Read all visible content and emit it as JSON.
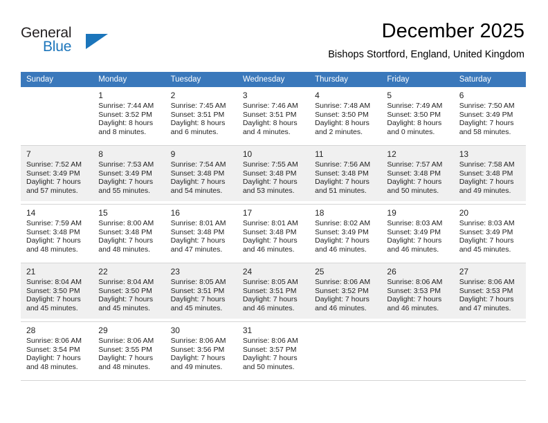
{
  "brand": {
    "word1": "General",
    "word2": "Blue",
    "triangle_color": "#1b75bb",
    "text_color": "#231f20"
  },
  "header": {
    "title": "December 2025",
    "subtitle": "Bishops Stortford, England, United Kingdom"
  },
  "theme": {
    "header_row_bg": "#3a78bb",
    "header_row_text": "#ffffff",
    "shaded_cell_bg": "#f0f0f0",
    "grid_line": "#d4d4d4"
  },
  "weekdays": [
    "Sunday",
    "Monday",
    "Tuesday",
    "Wednesday",
    "Thursday",
    "Friday",
    "Saturday"
  ],
  "weeks": [
    [
      {
        "day": "",
        "sunrise": "",
        "sunset": "",
        "daylight1": "",
        "daylight2": ""
      },
      {
        "day": "1",
        "sunrise": "Sunrise: 7:44 AM",
        "sunset": "Sunset: 3:52 PM",
        "daylight1": "Daylight: 8 hours",
        "daylight2": "and 8 minutes."
      },
      {
        "day": "2",
        "sunrise": "Sunrise: 7:45 AM",
        "sunset": "Sunset: 3:51 PM",
        "daylight1": "Daylight: 8 hours",
        "daylight2": "and 6 minutes."
      },
      {
        "day": "3",
        "sunrise": "Sunrise: 7:46 AM",
        "sunset": "Sunset: 3:51 PM",
        "daylight1": "Daylight: 8 hours",
        "daylight2": "and 4 minutes."
      },
      {
        "day": "4",
        "sunrise": "Sunrise: 7:48 AM",
        "sunset": "Sunset: 3:50 PM",
        "daylight1": "Daylight: 8 hours",
        "daylight2": "and 2 minutes."
      },
      {
        "day": "5",
        "sunrise": "Sunrise: 7:49 AM",
        "sunset": "Sunset: 3:50 PM",
        "daylight1": "Daylight: 8 hours",
        "daylight2": "and 0 minutes."
      },
      {
        "day": "6",
        "sunrise": "Sunrise: 7:50 AM",
        "sunset": "Sunset: 3:49 PM",
        "daylight1": "Daylight: 7 hours",
        "daylight2": "and 58 minutes."
      }
    ],
    [
      {
        "day": "7",
        "sunrise": "Sunrise: 7:52 AM",
        "sunset": "Sunset: 3:49 PM",
        "daylight1": "Daylight: 7 hours",
        "daylight2": "and 57 minutes."
      },
      {
        "day": "8",
        "sunrise": "Sunrise: 7:53 AM",
        "sunset": "Sunset: 3:49 PM",
        "daylight1": "Daylight: 7 hours",
        "daylight2": "and 55 minutes."
      },
      {
        "day": "9",
        "sunrise": "Sunrise: 7:54 AM",
        "sunset": "Sunset: 3:48 PM",
        "daylight1": "Daylight: 7 hours",
        "daylight2": "and 54 minutes."
      },
      {
        "day": "10",
        "sunrise": "Sunrise: 7:55 AM",
        "sunset": "Sunset: 3:48 PM",
        "daylight1": "Daylight: 7 hours",
        "daylight2": "and 53 minutes."
      },
      {
        "day": "11",
        "sunrise": "Sunrise: 7:56 AM",
        "sunset": "Sunset: 3:48 PM",
        "daylight1": "Daylight: 7 hours",
        "daylight2": "and 51 minutes."
      },
      {
        "day": "12",
        "sunrise": "Sunrise: 7:57 AM",
        "sunset": "Sunset: 3:48 PM",
        "daylight1": "Daylight: 7 hours",
        "daylight2": "and 50 minutes."
      },
      {
        "day": "13",
        "sunrise": "Sunrise: 7:58 AM",
        "sunset": "Sunset: 3:48 PM",
        "daylight1": "Daylight: 7 hours",
        "daylight2": "and 49 minutes."
      }
    ],
    [
      {
        "day": "14",
        "sunrise": "Sunrise: 7:59 AM",
        "sunset": "Sunset: 3:48 PM",
        "daylight1": "Daylight: 7 hours",
        "daylight2": "and 48 minutes."
      },
      {
        "day": "15",
        "sunrise": "Sunrise: 8:00 AM",
        "sunset": "Sunset: 3:48 PM",
        "daylight1": "Daylight: 7 hours",
        "daylight2": "and 48 minutes."
      },
      {
        "day": "16",
        "sunrise": "Sunrise: 8:01 AM",
        "sunset": "Sunset: 3:48 PM",
        "daylight1": "Daylight: 7 hours",
        "daylight2": "and 47 minutes."
      },
      {
        "day": "17",
        "sunrise": "Sunrise: 8:01 AM",
        "sunset": "Sunset: 3:48 PM",
        "daylight1": "Daylight: 7 hours",
        "daylight2": "and 46 minutes."
      },
      {
        "day": "18",
        "sunrise": "Sunrise: 8:02 AM",
        "sunset": "Sunset: 3:49 PM",
        "daylight1": "Daylight: 7 hours",
        "daylight2": "and 46 minutes."
      },
      {
        "day": "19",
        "sunrise": "Sunrise: 8:03 AM",
        "sunset": "Sunset: 3:49 PM",
        "daylight1": "Daylight: 7 hours",
        "daylight2": "and 46 minutes."
      },
      {
        "day": "20",
        "sunrise": "Sunrise: 8:03 AM",
        "sunset": "Sunset: 3:49 PM",
        "daylight1": "Daylight: 7 hours",
        "daylight2": "and 45 minutes."
      }
    ],
    [
      {
        "day": "21",
        "sunrise": "Sunrise: 8:04 AM",
        "sunset": "Sunset: 3:50 PM",
        "daylight1": "Daylight: 7 hours",
        "daylight2": "and 45 minutes."
      },
      {
        "day": "22",
        "sunrise": "Sunrise: 8:04 AM",
        "sunset": "Sunset: 3:50 PM",
        "daylight1": "Daylight: 7 hours",
        "daylight2": "and 45 minutes."
      },
      {
        "day": "23",
        "sunrise": "Sunrise: 8:05 AM",
        "sunset": "Sunset: 3:51 PM",
        "daylight1": "Daylight: 7 hours",
        "daylight2": "and 45 minutes."
      },
      {
        "day": "24",
        "sunrise": "Sunrise: 8:05 AM",
        "sunset": "Sunset: 3:51 PM",
        "daylight1": "Daylight: 7 hours",
        "daylight2": "and 46 minutes."
      },
      {
        "day": "25",
        "sunrise": "Sunrise: 8:06 AM",
        "sunset": "Sunset: 3:52 PM",
        "daylight1": "Daylight: 7 hours",
        "daylight2": "and 46 minutes."
      },
      {
        "day": "26",
        "sunrise": "Sunrise: 8:06 AM",
        "sunset": "Sunset: 3:53 PM",
        "daylight1": "Daylight: 7 hours",
        "daylight2": "and 46 minutes."
      },
      {
        "day": "27",
        "sunrise": "Sunrise: 8:06 AM",
        "sunset": "Sunset: 3:53 PM",
        "daylight1": "Daylight: 7 hours",
        "daylight2": "and 47 minutes."
      }
    ],
    [
      {
        "day": "28",
        "sunrise": "Sunrise: 8:06 AM",
        "sunset": "Sunset: 3:54 PM",
        "daylight1": "Daylight: 7 hours",
        "daylight2": "and 48 minutes."
      },
      {
        "day": "29",
        "sunrise": "Sunrise: 8:06 AM",
        "sunset": "Sunset: 3:55 PM",
        "daylight1": "Daylight: 7 hours",
        "daylight2": "and 48 minutes."
      },
      {
        "day": "30",
        "sunrise": "Sunrise: 8:06 AM",
        "sunset": "Sunset: 3:56 PM",
        "daylight1": "Daylight: 7 hours",
        "daylight2": "and 49 minutes."
      },
      {
        "day": "31",
        "sunrise": "Sunrise: 8:06 AM",
        "sunset": "Sunset: 3:57 PM",
        "daylight1": "Daylight: 7 hours",
        "daylight2": "and 50 minutes."
      },
      {
        "day": "",
        "sunrise": "",
        "sunset": "",
        "daylight1": "",
        "daylight2": ""
      },
      {
        "day": "",
        "sunrise": "",
        "sunset": "",
        "daylight1": "",
        "daylight2": ""
      },
      {
        "day": "",
        "sunrise": "",
        "sunset": "",
        "daylight1": "",
        "daylight2": ""
      }
    ]
  ]
}
